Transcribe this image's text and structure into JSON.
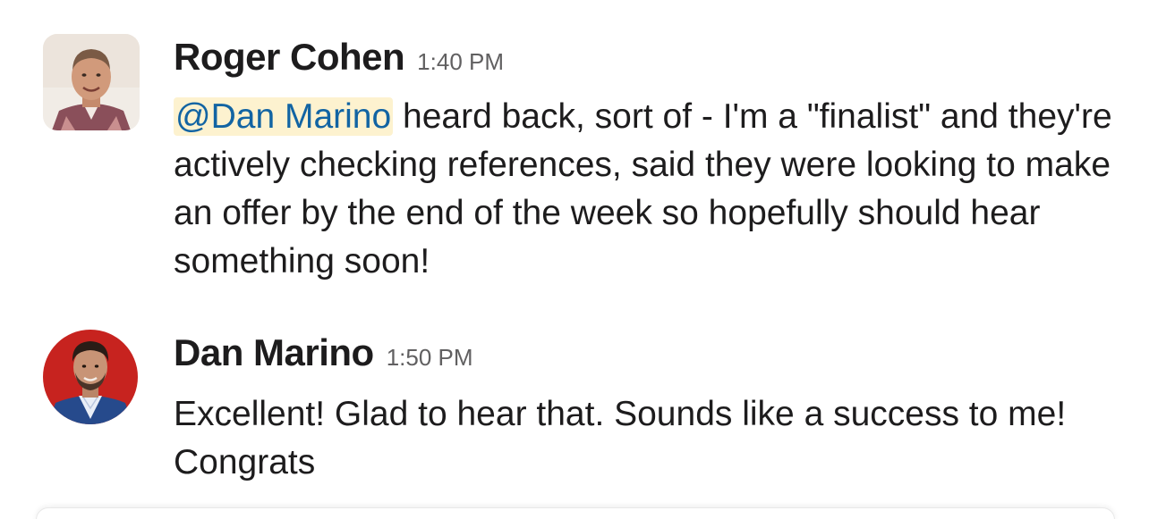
{
  "messages": [
    {
      "sender": "Roger Cohen",
      "time": "1:40 PM",
      "mention": "@Dan Marino",
      "text": " heard back, sort of - I'm a \"finalist\" and they're actively checking references, said they were looking to make an offer by the end of the week so hopefully should hear something soon!",
      "avatar": "roger-cohen-avatar"
    },
    {
      "sender": "Dan Marino",
      "time": "1:50 PM",
      "text": "Excellent! Glad to hear that. Sounds like a success to me! Congrats",
      "avatar": "dan-marino-avatar"
    }
  ],
  "colors": {
    "mention_bg": "#fdf2cf",
    "mention_text": "#1264a3",
    "timestamp": "#616061",
    "text": "#1d1c1d"
  }
}
